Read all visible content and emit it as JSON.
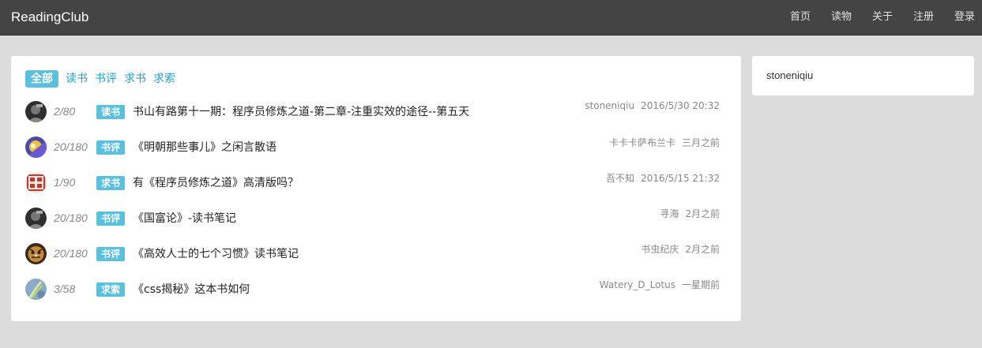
{
  "navbar": {
    "brand": "ReadingClub",
    "links": [
      "首页",
      "读物",
      "关于",
      "注册",
      "登录"
    ]
  },
  "sidebar": {
    "username": "stoneniqiu"
  },
  "filter_tabs": [
    "全部",
    "读书",
    "书评",
    "求书",
    "求索"
  ],
  "active_tab": "全部",
  "topics": [
    {
      "count": "2/80",
      "tag": "读书",
      "title": "书山有路第十一期：程序员修炼之道-第二章-注重实效的途径--第五天",
      "author": "stoneniqiu",
      "time": "2016/5/30 20:32",
      "avatar": "dark-portrait"
    },
    {
      "count": "20/180",
      "tag": "书评",
      "title": "《明朝那些事儿》之闲言散语",
      "author": "卡卡卡萨布兰卡",
      "time": "三月之前",
      "avatar": "anime-portrait"
    },
    {
      "count": "1/90",
      "tag": "求书",
      "title": "有《程序员修炼之道》高清版吗？",
      "author": "吾不知",
      "time": "2016/5/15 21:32",
      "avatar": "red-seal"
    },
    {
      "count": "20/180",
      "tag": "书评",
      "title": "《国富论》-读书笔记",
      "author": "寻海",
      "time": "2月之前",
      "avatar": "dark-portrait"
    },
    {
      "count": "20/180",
      "tag": "书评",
      "title": "《高效人士的七个习惯》读书笔记",
      "author": "书虫纪庆",
      "time": "2月之前",
      "avatar": "tiger"
    },
    {
      "count": "3/58",
      "tag": "求索",
      "title": "《css揭秘》这本书如何",
      "author": "Watery_D_Lotus",
      "time": "一星期前",
      "avatar": "green-leaf"
    }
  ],
  "colors": {
    "navbar": "#444444",
    "tag": "#5bc0de",
    "link": "#21a0c4",
    "background": "#dcdcdc"
  }
}
